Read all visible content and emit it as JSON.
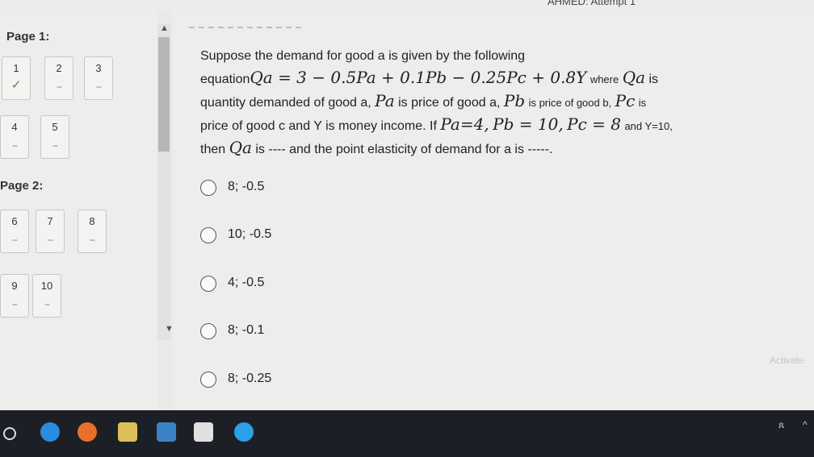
{
  "header": {
    "attempt_text": "AHMED: Attempt 1"
  },
  "nav": {
    "page1_label": "Page 1:",
    "page2_label": "Page 2:",
    "questions": [
      {
        "num": "1",
        "status": "✓"
      },
      {
        "num": "2",
        "status": "--"
      },
      {
        "num": "3",
        "status": "--"
      },
      {
        "num": "4",
        "status": "--"
      },
      {
        "num": "5",
        "status": "--"
      },
      {
        "num": "6",
        "status": "--"
      },
      {
        "num": "7",
        "status": "--"
      },
      {
        "num": "8",
        "status": "--"
      },
      {
        "num": "9",
        "status": "--"
      },
      {
        "num": "10",
        "status": "--"
      }
    ]
  },
  "question": {
    "intro": "Suppose the demand for good a is given by the following",
    "eq_prefix": "equation",
    "equation": "Qa = 3 − 0.5Pa + 0.1Pb − 0.25Pc + 0.8Y",
    "where": "where",
    "qa": "Qa",
    "is": "is",
    "line2a": "quantity demanded of good a,",
    "pa": "Pa",
    "line2b": "is price of good a,",
    "pb": "Pb",
    "line2c": "is price of good b,",
    "pc": "Pc",
    "line3": "price of good c and Y is money income. If",
    "given_pa": "Pa=4,",
    "given_pb": "Pb = 10,",
    "given_pc": "Pc = 8",
    "given_y": "and Y=10,",
    "then": "then",
    "line4": "is ---- and the point elasticity of demand for a is -----."
  },
  "options": [
    "8; -0.5",
    "10; -0.5",
    "4; -0.5",
    "8; -0.1",
    "8; -0.25"
  ],
  "watermark": "Activate"
}
